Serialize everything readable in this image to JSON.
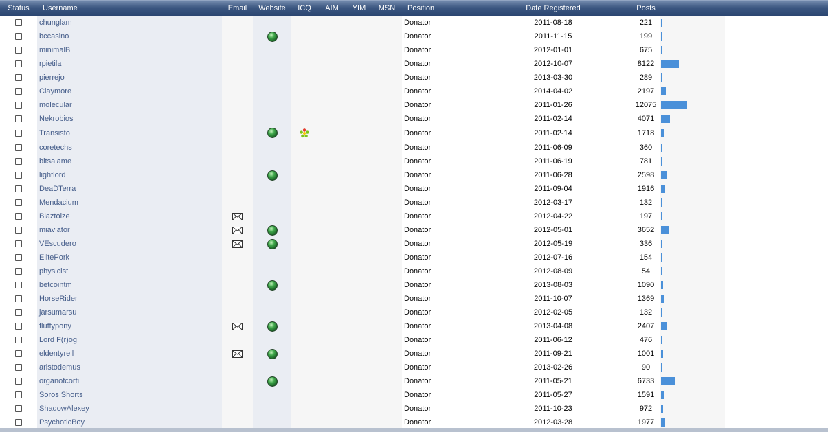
{
  "columns": {
    "status": "Status",
    "username": "Username",
    "email": "Email",
    "website": "Website",
    "icq": "ICQ",
    "aim": "AIM",
    "yim": "YIM",
    "msn": "MSN",
    "position": "Position",
    "date_registered": "Date Registered",
    "posts": "Posts"
  },
  "colors": {
    "header_bg": "#3b5680",
    "username_link": "#455d8a",
    "posts_bar": "#4a90d9"
  },
  "icons": {
    "status": "checkbox-icon",
    "email": "envelope-icon",
    "website": "globe-icon",
    "icq": "icq-flower-icon"
  },
  "members": [
    {
      "username": "chunglam",
      "email": false,
      "website": false,
      "icq": false,
      "position": "Donator",
      "date": "2011-08-18",
      "posts": "221",
      "posts_value": 221
    },
    {
      "username": "bccasino",
      "email": false,
      "website": true,
      "icq": false,
      "position": "Donator",
      "date": "2011-11-15",
      "posts": "199",
      "posts_value": 199
    },
    {
      "username": "minimalB",
      "email": false,
      "website": false,
      "icq": false,
      "position": "Donator",
      "date": "2012-01-01",
      "posts": "675",
      "posts_value": 675
    },
    {
      "username": "rpietila",
      "email": false,
      "website": false,
      "icq": false,
      "position": "Donator",
      "date": "2012-10-07",
      "posts": "8122",
      "posts_value": 8122
    },
    {
      "username": "pierrejo",
      "email": false,
      "website": false,
      "icq": false,
      "position": "Donator",
      "date": "2013-03-30",
      "posts": "289",
      "posts_value": 289
    },
    {
      "username": "Claymore",
      "email": false,
      "website": false,
      "icq": false,
      "position": "Donator",
      "date": "2014-04-02",
      "posts": "2197",
      "posts_value": 2197
    },
    {
      "username": "molecular",
      "email": false,
      "website": false,
      "icq": false,
      "position": "Donator",
      "date": "2011-01-26",
      "posts": "12075",
      "posts_value": 12075
    },
    {
      "username": "Nekrobios",
      "email": false,
      "website": false,
      "icq": false,
      "position": "Donator",
      "date": "2011-02-14",
      "posts": "4071",
      "posts_value": 4071
    },
    {
      "username": "Transisto",
      "email": false,
      "website": true,
      "icq": true,
      "position": "Donator",
      "date": "2011-02-14",
      "posts": "1718",
      "posts_value": 1718
    },
    {
      "username": "coretechs",
      "email": false,
      "website": false,
      "icq": false,
      "position": "Donator",
      "date": "2011-06-09",
      "posts": "360",
      "posts_value": 360
    },
    {
      "username": "bitsalame",
      "email": false,
      "website": false,
      "icq": false,
      "position": "Donator",
      "date": "2011-06-19",
      "posts": "781",
      "posts_value": 781
    },
    {
      "username": "lightlord",
      "email": false,
      "website": true,
      "icq": false,
      "position": "Donator",
      "date": "2011-06-28",
      "posts": "2598",
      "posts_value": 2598
    },
    {
      "username": "DeaDTerra",
      "email": false,
      "website": false,
      "icq": false,
      "position": "Donator",
      "date": "2011-09-04",
      "posts": "1916",
      "posts_value": 1916
    },
    {
      "username": "Mendacium",
      "email": false,
      "website": false,
      "icq": false,
      "position": "Donator",
      "date": "2012-03-17",
      "posts": "132",
      "posts_value": 132
    },
    {
      "username": "Blaztoize",
      "email": true,
      "website": false,
      "icq": false,
      "position": "Donator",
      "date": "2012-04-22",
      "posts": "197",
      "posts_value": 197
    },
    {
      "username": "miaviator",
      "email": true,
      "website": true,
      "icq": false,
      "position": "Donator",
      "date": "2012-05-01",
      "posts": "3652",
      "posts_value": 3652
    },
    {
      "username": "VEscudero",
      "email": true,
      "website": true,
      "icq": false,
      "position": "Donator",
      "date": "2012-05-19",
      "posts": "336",
      "posts_value": 336
    },
    {
      "username": "ElitePork",
      "email": false,
      "website": false,
      "icq": false,
      "position": "Donator",
      "date": "2012-07-16",
      "posts": "154",
      "posts_value": 154
    },
    {
      "username": "physicist",
      "email": false,
      "website": false,
      "icq": false,
      "position": "Donator",
      "date": "2012-08-09",
      "posts": "54",
      "posts_value": 54
    },
    {
      "username": "betcointm",
      "email": false,
      "website": true,
      "icq": false,
      "position": "Donator",
      "date": "2013-08-03",
      "posts": "1090",
      "posts_value": 1090
    },
    {
      "username": "HorseRider",
      "email": false,
      "website": false,
      "icq": false,
      "position": "Donator",
      "date": "2011-10-07",
      "posts": "1369",
      "posts_value": 1369
    },
    {
      "username": "jarsumarsu",
      "email": false,
      "website": false,
      "icq": false,
      "position": "Donator",
      "date": "2012-02-05",
      "posts": "132",
      "posts_value": 132
    },
    {
      "username": "fluffypony",
      "email": true,
      "website": true,
      "icq": false,
      "position": "Donator",
      "date": "2013-04-08",
      "posts": "2407",
      "posts_value": 2407
    },
    {
      "username": "Lord F(r)og",
      "email": false,
      "website": false,
      "icq": false,
      "position": "Donator",
      "date": "2011-06-12",
      "posts": "476",
      "posts_value": 476
    },
    {
      "username": "eldentyrell",
      "email": true,
      "website": true,
      "icq": false,
      "position": "Donator",
      "date": "2011-09-21",
      "posts": "1001",
      "posts_value": 1001
    },
    {
      "username": "aristodemus",
      "email": false,
      "website": false,
      "icq": false,
      "position": "Donator",
      "date": "2013-02-26",
      "posts": "90",
      "posts_value": 90
    },
    {
      "username": "organofcorti",
      "email": false,
      "website": true,
      "icq": false,
      "position": "Donator",
      "date": "2011-05-21",
      "posts": "6733",
      "posts_value": 6733
    },
    {
      "username": "Soros Shorts",
      "email": false,
      "website": false,
      "icq": false,
      "position": "Donator",
      "date": "2011-05-27",
      "posts": "1591",
      "posts_value": 1591
    },
    {
      "username": "ShadowAlexey",
      "email": false,
      "website": false,
      "icq": false,
      "position": "Donator",
      "date": "2011-10-23",
      "posts": "972",
      "posts_value": 972
    },
    {
      "username": "PsychoticBoy",
      "email": false,
      "website": false,
      "icq": false,
      "position": "Donator",
      "date": "2012-03-28",
      "posts": "1977",
      "posts_value": 1977
    }
  ],
  "posts_bar_max": 12075
}
